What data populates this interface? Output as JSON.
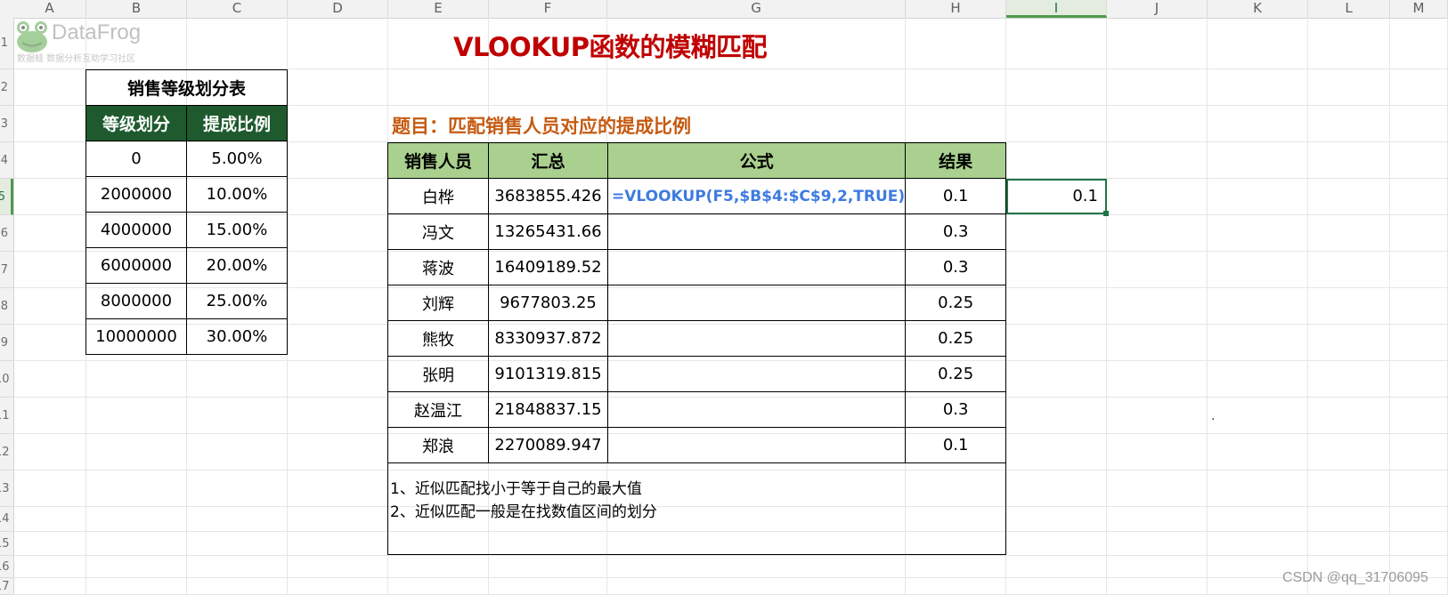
{
  "columns": [
    {
      "label": "A"
    },
    {
      "label": "B"
    },
    {
      "label": "C"
    },
    {
      "label": "D"
    },
    {
      "label": "E"
    },
    {
      "label": "F"
    },
    {
      "label": "G"
    },
    {
      "label": "H"
    },
    {
      "label": "I",
      "active": true
    },
    {
      "label": "J"
    },
    {
      "label": "K"
    },
    {
      "label": "L"
    },
    {
      "label": "M"
    }
  ],
  "rows": [
    {
      "label": "1"
    },
    {
      "label": "2"
    },
    {
      "label": "3"
    },
    {
      "label": "4"
    },
    {
      "label": "5",
      "active": true
    },
    {
      "label": "6"
    },
    {
      "label": "7"
    },
    {
      "label": "8"
    },
    {
      "label": "9"
    },
    {
      "label": "10"
    },
    {
      "label": "11"
    },
    {
      "label": "12"
    },
    {
      "label": "13"
    },
    {
      "label": "14"
    },
    {
      "label": "15"
    },
    {
      "label": "16"
    },
    {
      "label": "17"
    }
  ],
  "logo": {
    "name": "DataFrog",
    "tagline": "数据蛙   数据分析互助学习社区"
  },
  "title": "VLOOKUP函数的模糊匹配",
  "question": "题目：匹配销售人员对应的提成比例",
  "grade_table": {
    "title": "销售等级划分表",
    "headers": [
      "等级划分",
      "提成比例"
    ],
    "rows": [
      [
        "0",
        "5.00%"
      ],
      [
        "2000000",
        "10.00%"
      ],
      [
        "4000000",
        "15.00%"
      ],
      [
        "6000000",
        "20.00%"
      ],
      [
        "8000000",
        "25.00%"
      ],
      [
        "10000000",
        "30.00%"
      ]
    ]
  },
  "sales_table": {
    "headers": [
      "销售人员",
      "汇总",
      "公式",
      "结果"
    ],
    "rows": [
      {
        "name": "白桦",
        "total": "3683855.426",
        "formula": "=VLOOKUP(F5,$B$4:$C$9,2,TRUE)",
        "result": "0.1"
      },
      {
        "name": "冯文",
        "total": "13265431.66",
        "formula": "",
        "result": "0.3"
      },
      {
        "name": "蒋波",
        "total": "16409189.52",
        "formula": "",
        "result": "0.3"
      },
      {
        "name": "刘辉",
        "total": "9677803.25",
        "formula": "",
        "result": "0.25"
      },
      {
        "name": "熊牧",
        "total": "8330937.872",
        "formula": "",
        "result": "0.25"
      },
      {
        "name": "张明",
        "total": "9101319.815",
        "formula": "",
        "result": "0.25"
      },
      {
        "name": "赵温江",
        "total": "21848837.15",
        "formula": "",
        "result": "0.3"
      },
      {
        "name": "郑浪",
        "total": "2270089.947",
        "formula": "",
        "result": "0.1"
      }
    ],
    "notes": [
      "1、近似匹配找小于等于自己的最大值",
      "2、近似匹配一般是在找数值区间的划分"
    ]
  },
  "selected_cell": {
    "value": "0.1"
  },
  "stray_mark": "·",
  "watermark": "CSDN @qq_31706095",
  "colors": {
    "title": "#c00000",
    "question": "#c55a11",
    "grade_header": "#1e5a2d",
    "sales_header": "#a9d08e",
    "formula": "#3e7be0",
    "selection": "#217346"
  }
}
